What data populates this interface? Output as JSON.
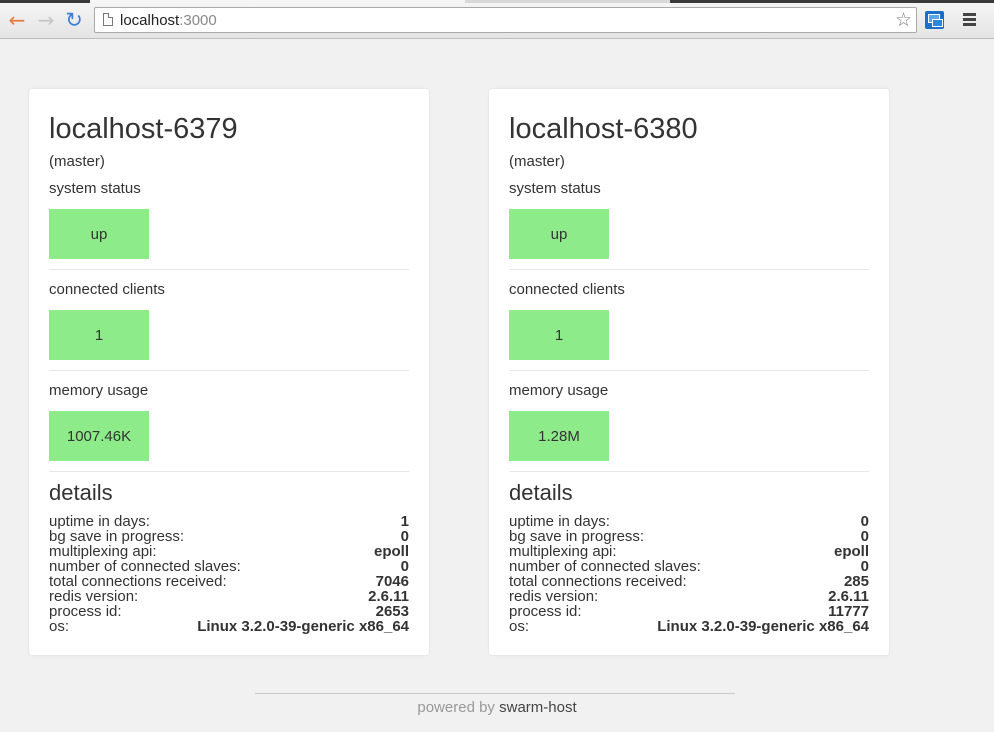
{
  "browser": {
    "url_host": "localhost",
    "url_port": ":3000"
  },
  "servers": [
    {
      "name": "localhost-6379",
      "role": "(master)",
      "system_status_label": "system status",
      "system_status": "up",
      "clients_label": "connected clients",
      "clients": "1",
      "memory_label": "memory usage",
      "memory": "1007.46K",
      "details_title": "details",
      "details": [
        {
          "label": "uptime in days:",
          "value": "1"
        },
        {
          "label": "bg save in progress:",
          "value": "0"
        },
        {
          "label": "multiplexing api:",
          "value": "epoll"
        },
        {
          "label": "number of connected slaves:",
          "value": "0"
        },
        {
          "label": "total connections received:",
          "value": "7046"
        },
        {
          "label": "redis version:",
          "value": "2.6.11"
        },
        {
          "label": "process id:",
          "value": "2653"
        },
        {
          "label": "os:",
          "value": "Linux 3.2.0-39-generic x86_64"
        }
      ]
    },
    {
      "name": "localhost-6380",
      "role": "(master)",
      "system_status_label": "system status",
      "system_status": "up",
      "clients_label": "connected clients",
      "clients": "1",
      "memory_label": "memory usage",
      "memory": "1.28M",
      "details_title": "details",
      "details": [
        {
          "label": "uptime in days:",
          "value": "0"
        },
        {
          "label": "bg save in progress:",
          "value": "0"
        },
        {
          "label": "multiplexing api:",
          "value": "epoll"
        },
        {
          "label": "number of connected slaves:",
          "value": "0"
        },
        {
          "label": "total connections received:",
          "value": "285"
        },
        {
          "label": "redis version:",
          "value": "2.6.11"
        },
        {
          "label": "process id:",
          "value": "11777"
        },
        {
          "label": "os:",
          "value": "Linux 3.2.0-39-generic x86_64"
        }
      ]
    }
  ],
  "footer": {
    "prefix": "powered by",
    "brand": "swarm-host"
  },
  "colors": {
    "status_ok": "#8deb8a",
    "back_arrow": "#e8793a",
    "reload": "#3b7fd9"
  },
  "icons": {
    "back": "back-arrow-icon",
    "forward": "forward-arrow-icon",
    "reload": "reload-icon",
    "page": "page-icon",
    "bookmark": "star-icon",
    "extension": "extension-icon",
    "menu": "hamburger-menu-icon"
  }
}
